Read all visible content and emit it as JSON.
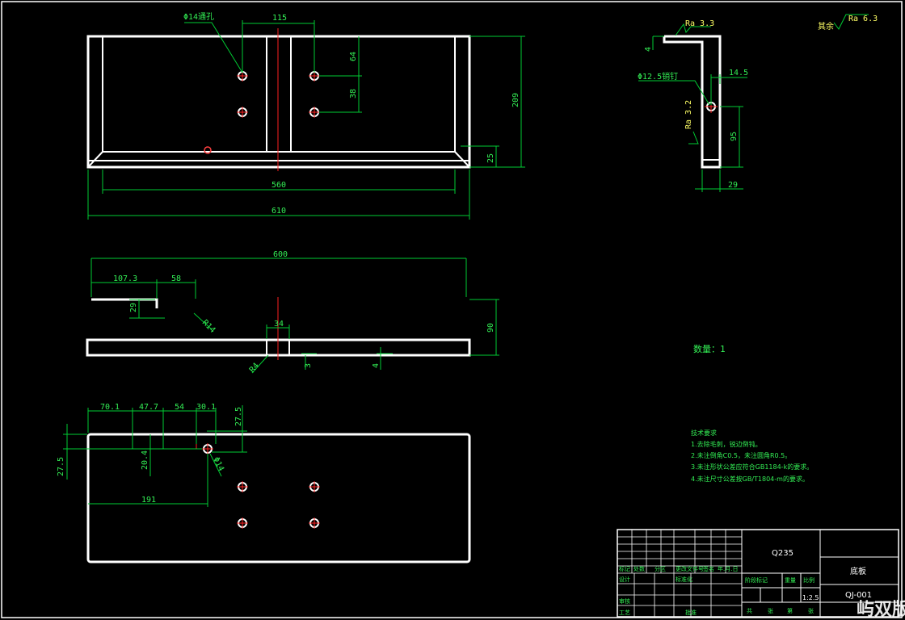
{
  "colors": {
    "background": "#000000",
    "geometry": "#ffffff",
    "dimension": "#00cc33",
    "center": "#ff2020",
    "text": "#33ee55"
  },
  "front_view": {
    "hole_note": "Φ14通孔",
    "dim_115": "115",
    "dim_64": "64",
    "dim_38": "38",
    "dim_209": "209",
    "dim_25": "25",
    "dim_560": "560",
    "dim_610": "610"
  },
  "side_view": {
    "rough_33": "Ra 3.3",
    "dim_4": "4",
    "pin_note": "Φ12.5销钉",
    "dim_14_5": "14.5",
    "rough_32": "Ra 3.2",
    "dim_95": "95",
    "dim_29": "29"
  },
  "roughness_other": {
    "label": "其余",
    "value": "Ra 6.3"
  },
  "top_view": {
    "dim_600": "600",
    "dim_107_3": "107.3",
    "dim_58": "58",
    "dim_29": "29",
    "dim_r14": "R14",
    "dim_90": "90",
    "dim_34": "34",
    "dim_r4": "R4",
    "dim_3": "3",
    "dim_4": "4"
  },
  "bottom_view": {
    "dim_70_1": "70.1",
    "dim_47_7": "47.7",
    "dim_54": "54",
    "dim_30_1": "30.1",
    "dim_27_5_top": "27.5",
    "dim_27_5_left": "27.5",
    "dim_20_4": "20.4",
    "dim_191": "191",
    "dim_phi14": "Φ14"
  },
  "quantity_note": "数量：1",
  "tech_requirements": {
    "title": "技术要求",
    "items": [
      "1.去除毛刺，锐边倒钝。",
      "2.未注倒角C0.5，未注圆角R0.5。",
      "3.未注形状公差应符合GB1184-k的要求。",
      "4.未注尺寸公差按GB/T1804-m的要求。"
    ]
  },
  "title_block": {
    "material": "Q235",
    "part_name": "底板",
    "drawing_no": "QJ-001",
    "scale": "1:2.5",
    "header_cells": [
      "标记",
      "处数",
      "分区",
      "更改文件号",
      "签名",
      "年.月.日"
    ],
    "design_label": "设计",
    "standard_label": "标准化",
    "review_label": "审核",
    "process_label": "工艺",
    "approve_label": "批准",
    "stage_label": "阶段标记",
    "weight_label": "重量",
    "scale_label": "比例",
    "sheet_cells": [
      "共",
      "张",
      "第",
      "张"
    ]
  },
  "watermark": "屿双版"
}
